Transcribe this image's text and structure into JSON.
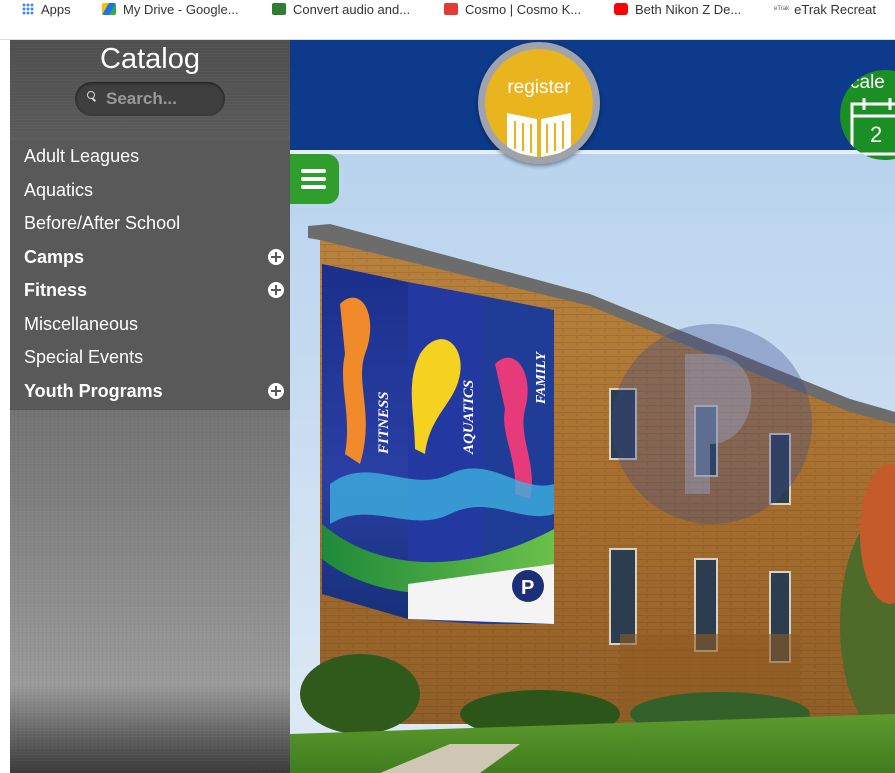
{
  "bookmarks": [
    {
      "label": "Apps",
      "icon": "apps-grid-icon",
      "color": "#4285f4"
    },
    {
      "label": "My Drive - Google...",
      "icon": "google-drive-icon",
      "color": "#1a73e8"
    },
    {
      "label": "Convert audio and...",
      "icon": "convert-icon",
      "color": "#2e7d32"
    },
    {
      "label": "Cosmo | Cosmo K...",
      "icon": "cosmo-icon",
      "color": "#e53935"
    },
    {
      "label": "Beth Nikon Z De...",
      "icon": "youtube-icon",
      "color": "#ff0000"
    },
    {
      "label": "eTrak Recreat",
      "icon": "etrak-icon",
      "color": "#555555",
      "badge": "eTrak"
    }
  ],
  "sidebar": {
    "title": "Catalog",
    "search_placeholder": "Search...",
    "items": [
      {
        "label": "Adult Leagues",
        "bold": false,
        "expandable": false
      },
      {
        "label": "Aquatics",
        "bold": false,
        "expandable": false
      },
      {
        "label": "Before/After School",
        "bold": false,
        "expandable": false
      },
      {
        "label": "Camps",
        "bold": true,
        "expandable": true
      },
      {
        "label": "Fitness",
        "bold": true,
        "expandable": true
      },
      {
        "label": "Miscellaneous",
        "bold": false,
        "expandable": false
      },
      {
        "label": "Special Events",
        "bold": false,
        "expandable": false
      },
      {
        "label": "Youth Programs",
        "bold": true,
        "expandable": true
      }
    ]
  },
  "header": {
    "register_label": "register",
    "calendar_label": "cale",
    "calendar_number": "2",
    "brand_color": "#0d3a8b",
    "register_color": "#eab41e",
    "calendar_color": "#1b8f23",
    "toggle_color": "#2f9e2d"
  },
  "banner": {
    "words": [
      "FITNESS",
      "AQUATICS",
      "FAMILY"
    ],
    "logo_letter": "P"
  }
}
